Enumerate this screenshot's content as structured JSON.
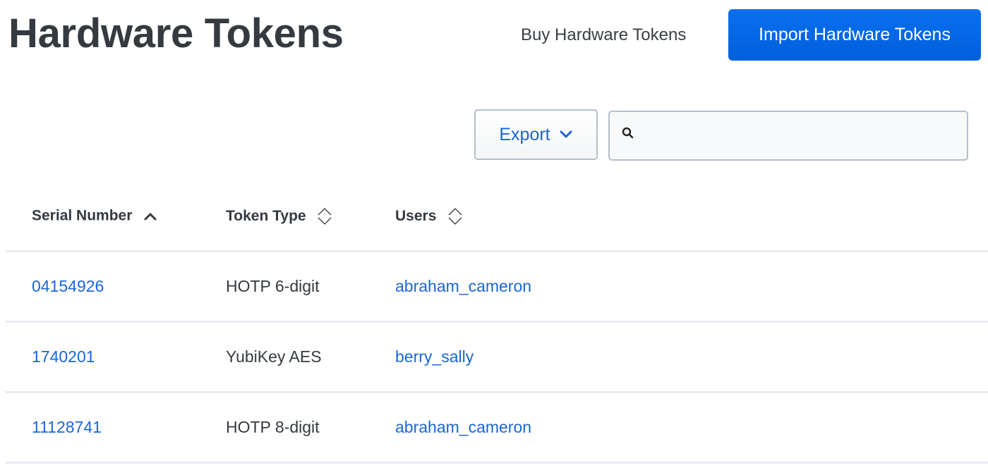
{
  "header": {
    "title": "Hardware Tokens",
    "buy_link": "Buy Hardware Tokens",
    "import_button": "Import Hardware Tokens"
  },
  "toolbar": {
    "export_label": "Export",
    "export_icon": "chevron-down-icon",
    "search_icon": "search-icon",
    "search_value": "",
    "search_placeholder": ""
  },
  "colors": {
    "primary": "#0066e0",
    "link": "#1a66d6",
    "text": "#343a40"
  },
  "table": {
    "columns": [
      {
        "label": "Serial Number",
        "sort": "ascending",
        "sort_icon": "chevron-up-icon"
      },
      {
        "label": "Token Type",
        "sort": "none",
        "sort_icon": "sort-icon"
      },
      {
        "label": "Users",
        "sort": "none",
        "sort_icon": "sort-icon"
      }
    ],
    "rows": [
      {
        "serial": "04154926",
        "type": "HOTP 6-digit",
        "user": "abraham_cameron"
      },
      {
        "serial": "1740201",
        "type": "YubiKey AES",
        "user": "berry_sally"
      },
      {
        "serial": "11128741",
        "type": "HOTP 8-digit",
        "user": "abraham_cameron"
      }
    ]
  }
}
